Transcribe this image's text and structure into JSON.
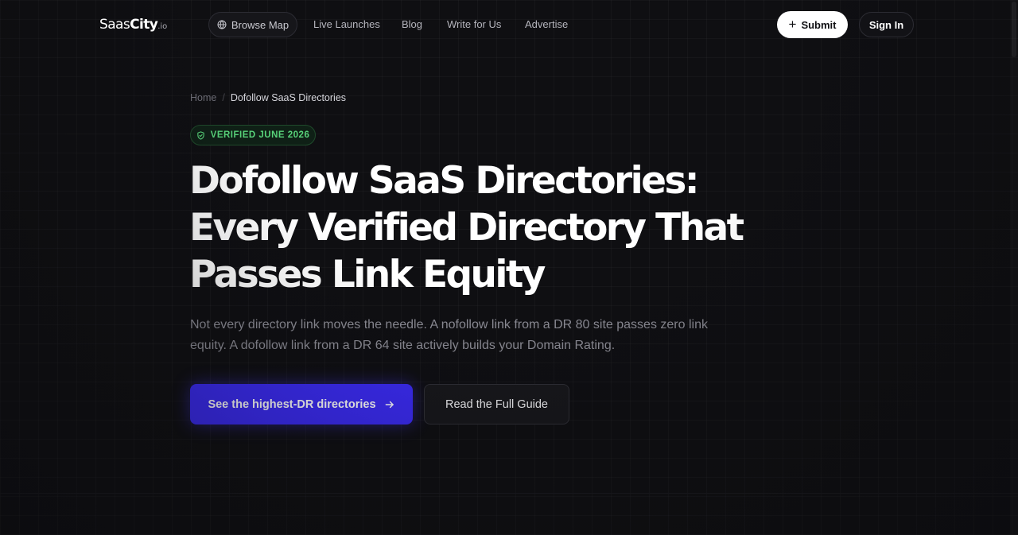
{
  "brand": {
    "name_regular": "Saas",
    "name_bold": "City",
    "name_suffix": ".io"
  },
  "nav": {
    "browse_map": "Browse Map",
    "links": [
      "Live Launches",
      "Blog",
      "Write for Us",
      "Advertise"
    ],
    "submit": "Submit",
    "sign_in": "Sign In"
  },
  "breadcrumb": {
    "home": "Home",
    "separator": "/",
    "current": "Dofollow SaaS Directories"
  },
  "badge": {
    "text": "VERIFIED JUNE 2026",
    "color": "#58d37a"
  },
  "hero": {
    "title_lines": [
      "Dofollow SaaS Directories:",
      "Every Verified Directory That",
      "Passes Link Equity"
    ],
    "lead": "Not every directory link moves the needle. A nofollow link from a DR 80 site passes zero link equity. A dofollow link from a DR 64 site actively builds your Domain Rating.",
    "primary_cta": "See the highest-DR directories",
    "secondary_cta": "Read the Full Guide"
  },
  "colors": {
    "background": "#0f0f12",
    "accent": "#3b2bf5",
    "success": "#58d37a"
  },
  "icons": {
    "browse": "globe-icon",
    "submit": "plus-icon",
    "badge": "shield-check-icon",
    "cta": "arrow-right-icon"
  }
}
